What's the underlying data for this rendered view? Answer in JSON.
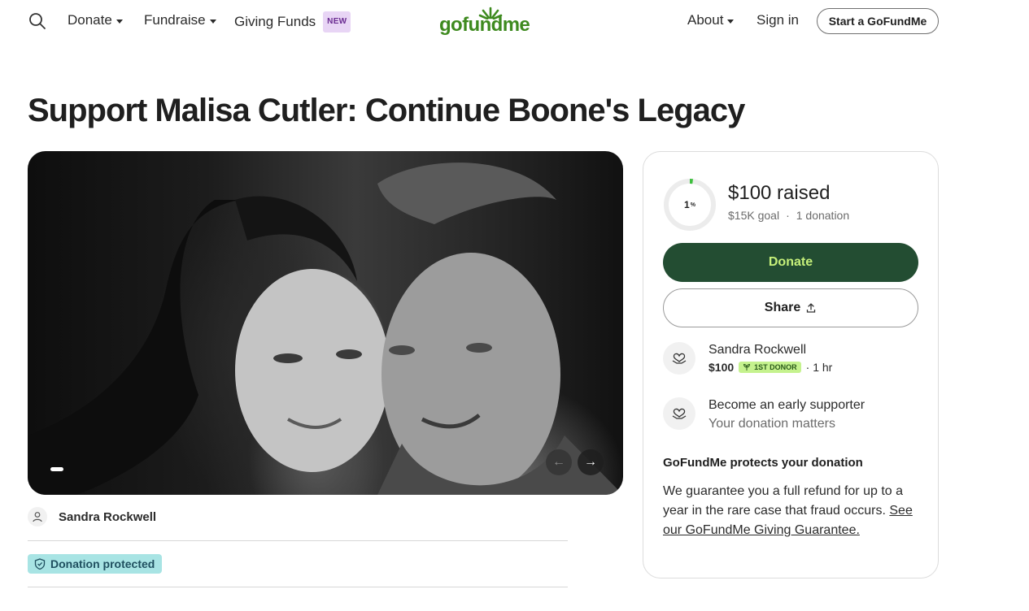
{
  "header": {
    "nav": [
      {
        "label": "Donate"
      },
      {
        "label": "Fundraise"
      },
      {
        "label": "Giving Funds",
        "badge": "NEW"
      }
    ],
    "logo_text": "gofundme",
    "about_label": "About",
    "signin_label": "Sign in",
    "start_label": "Start a GoFundMe"
  },
  "page": {
    "title": "Support Malisa Cutler: Continue Boone's Legacy"
  },
  "hero": {
    "carousel_prev_icon": "arrow-left-icon",
    "carousel_next_icon": "arrow-right-icon"
  },
  "organizer": {
    "name": "Sandra Rockwell",
    "protected_label": "Donation protected"
  },
  "sidebar": {
    "progress_percent": "1",
    "progress_suffix": "%",
    "progress_fraction": 0.0067,
    "raised": "$100 raised",
    "goal": "$15K goal",
    "separator": "·",
    "donations": "1 donation",
    "donate_label": "Donate",
    "share_label": "Share",
    "recent_donation": {
      "name": "Sandra Rockwell",
      "amount": "$100",
      "badge": "1ST DONOR",
      "time": "· 1 hr"
    },
    "early": {
      "title": "Become an early supporter",
      "subtitle": "Your donation matters"
    },
    "protect_title": "GoFundMe protects your donation",
    "protect_text": "We guarantee you a full refund for up to a year in the rare case that fraud occurs.",
    "protect_link": "See our GoFundMe Giving Guarantee."
  },
  "colors": {
    "brand_green": "#3e8a1f",
    "donate_bg": "#234d32",
    "donate_text": "#c6f07a",
    "protected_badge": "#a8e4e4",
    "new_badge": "#e8d5f5",
    "first_donor_badge": "#c5f28e"
  }
}
